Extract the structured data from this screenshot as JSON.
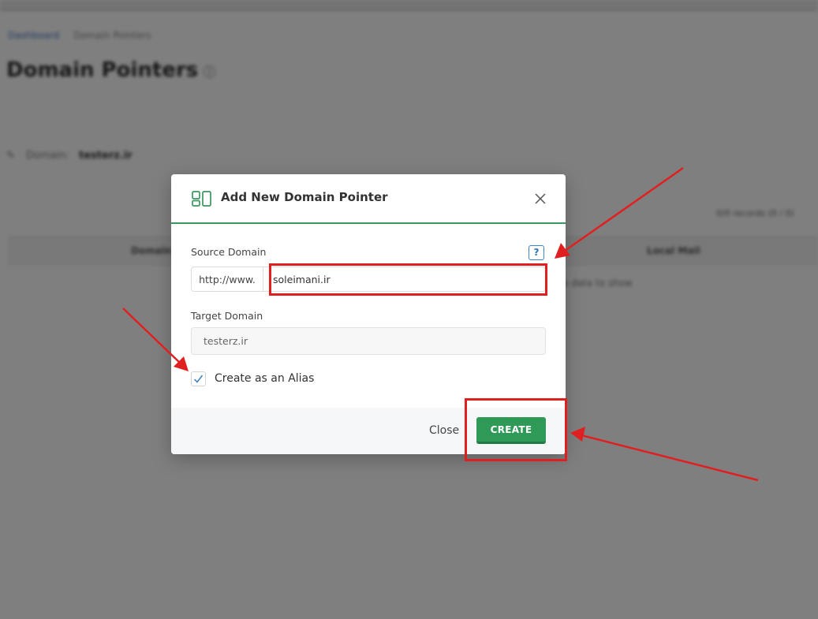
{
  "background": {
    "breadcrumb": [
      "Dashboard",
      "Domain Pointers"
    ],
    "page_title": "Domain Pointers",
    "domain_label": "Domain:",
    "domain_value": "testerz.ir",
    "records_text": "0/0 records (0 / 0)",
    "table_headers": [
      "Domain",
      "Local Mail"
    ],
    "empty_text": "No data to show"
  },
  "modal": {
    "title": "Add New Domain Pointer",
    "icon": "domain-pointer-icon",
    "source_label": "Source Domain",
    "help_label": "?",
    "source_prefix": "http://www.",
    "source_value": "soleimani.ir",
    "target_label": "Target Domain",
    "target_value": "testerz.ir",
    "alias_label": "Create as an Alias",
    "alias_checked": true,
    "close_label": "Close",
    "create_label": "CREATE"
  },
  "colors": {
    "accent": "#2f9a58",
    "annotation": "#e02020",
    "help": "#3a85c7"
  }
}
